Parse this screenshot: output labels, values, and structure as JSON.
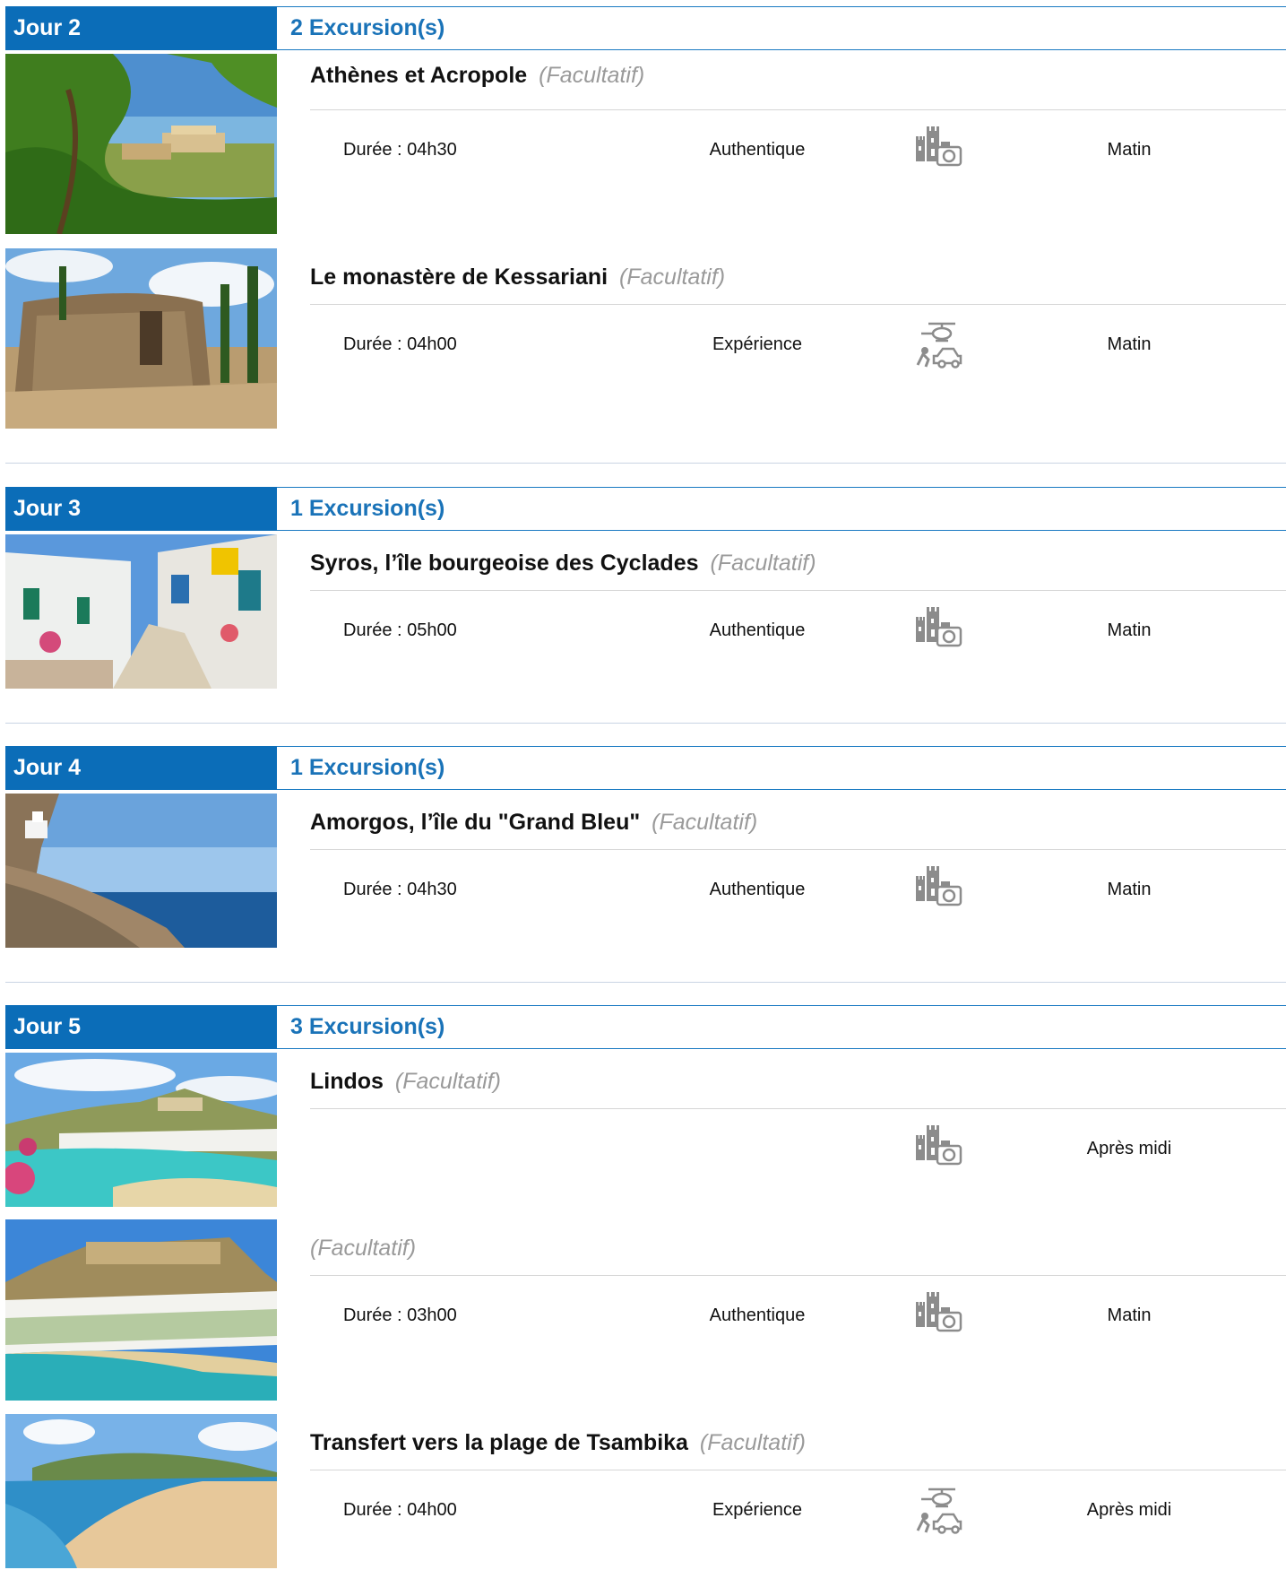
{
  "days": [
    {
      "label": "Jour 2",
      "count": "2 Excursion(s)",
      "excursions": [
        {
          "title": "Athènes et Acropole",
          "optional": "(Facultatif)",
          "duration": "Durée : 04h30",
          "theme": "Authentique",
          "icon": "castle-camera-icon",
          "moment": "Matin",
          "image": "acropolis-photo"
        },
        {
          "title": "Le monastère de Kessariani",
          "optional": "(Facultatif)",
          "duration": "Durée : 04h00",
          "theme": "Expérience",
          "icon": "helicopter-car-icon",
          "moment": "Matin",
          "image": "monastery-ruins-photo"
        }
      ]
    },
    {
      "label": "Jour 3",
      "count": "1 Excursion(s)",
      "excursions": [
        {
          "title": "Syros, l’île bourgeoise des Cyclades",
          "optional": "(Facultatif)",
          "duration": "Durée : 05h00",
          "theme": "Authentique",
          "icon": "castle-camera-icon",
          "moment": "Matin",
          "image": "cycladic-street-photo"
        }
      ]
    },
    {
      "label": "Jour 4",
      "count": "1 Excursion(s)",
      "excursions": [
        {
          "title": "Amorgos, l’île du \"Grand Bleu\"",
          "optional": "(Facultatif)",
          "duration": "Durée : 04h30",
          "theme": "Authentique",
          "icon": "castle-camera-icon",
          "moment": "Matin",
          "image": "cliff-monastery-photo"
        }
      ]
    },
    {
      "label": "Jour 5",
      "count": "3 Excursion(s)",
      "excursions": [
        {
          "title": "Lindos",
          "optional": "(Facultatif)",
          "duration": "",
          "theme": "",
          "icon": "castle-camera-icon",
          "moment": "Après midi",
          "image": "lindos-bay-photo"
        },
        {
          "title": "",
          "optional": "(Facultatif)",
          "duration": "Durée : 03h00",
          "theme": "Authentique",
          "icon": "castle-camera-icon",
          "moment": "Matin",
          "image": "lindos-village-photo"
        },
        {
          "title": "Transfert vers la plage de Tsambika",
          "optional": "(Facultatif)",
          "duration": "Durée : 04h00",
          "theme": "Expérience",
          "icon": "helicopter-car-icon",
          "moment": "Après midi",
          "image": "tsambika-beach-photo"
        }
      ]
    }
  ],
  "colors": {
    "accent": "#0b6db8",
    "accent_text": "#1a73b8",
    "optional_text": "#9a9a9a",
    "icon_gray": "#8a8a8a"
  }
}
